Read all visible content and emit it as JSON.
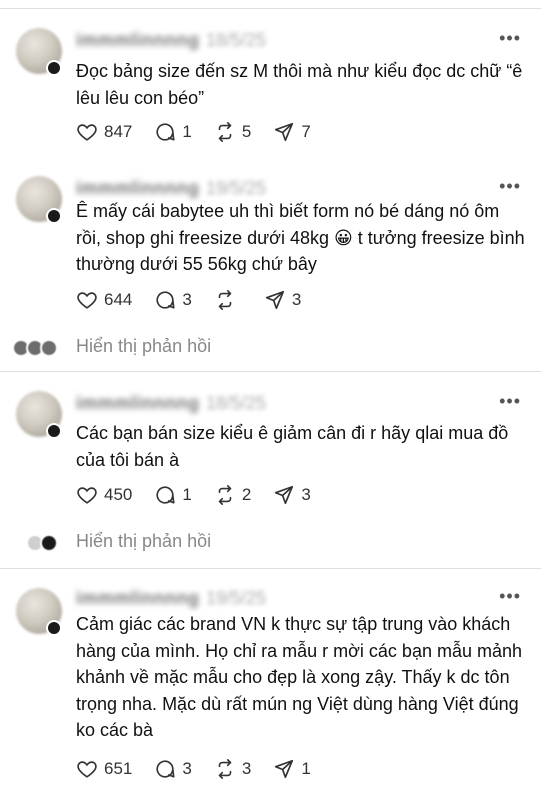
{
  "colors": {
    "text": "#111111",
    "muted": "#888888",
    "divider": "#e0e0e0"
  },
  "icons": {
    "like": "heart-icon",
    "reply": "comment-icon",
    "repost": "repost-icon",
    "share": "send-icon",
    "more": "more-horizontal-icon"
  },
  "posts": [
    {
      "username": "immmlinnnng",
      "date": "18/5/25",
      "more": "•••",
      "text": "Đọc bảng size đến sz M thôi mà như kiểu đọc dc chữ “ê lêu lêu con béo”",
      "likes": "847",
      "replies": "1",
      "reposts": "5",
      "shares": "7"
    },
    {
      "username": "immmlinnnng",
      "date": "19/5/25",
      "more": "•••",
      "text": "Ê mấy cái babytee uh thì biết form nó bé dáng nó ôm rồi, shop ghi freesize dưới 48kg 😀 t tưởng freesize bình thường dưới 55 56kg chứ bây",
      "likes": "644",
      "replies": "3",
      "reposts": "",
      "shares": "3",
      "show_replies": "Hiển thị phản hồi"
    },
    {
      "username": "immmlinnnng",
      "date": "18/5/25",
      "more": "•••",
      "text": "Các bạn bán size kiểu ê giảm cân đi r hãy qlai mua đồ của tôi bán à",
      "likes": "450",
      "replies": "1",
      "reposts": "2",
      "shares": "3",
      "show_replies": "Hiển thị phản hồi"
    },
    {
      "username": "immmlinnnng",
      "date": "19/5/25",
      "more": "•••",
      "text": "Cảm giác các brand VN k thực sự tập trung vào khách hàng của mình. Họ chỉ ra mẫu r mời các bạn mẫu mảnh khảnh về mặc mẫu cho đẹp là xong zậy. Thấy k dc tôn trọng nha. Mặc dù rất mún ng Việt dùng hàng Việt đúng ko các bà",
      "likes": "651",
      "replies": "3",
      "reposts": "3",
      "shares": "1"
    }
  ]
}
